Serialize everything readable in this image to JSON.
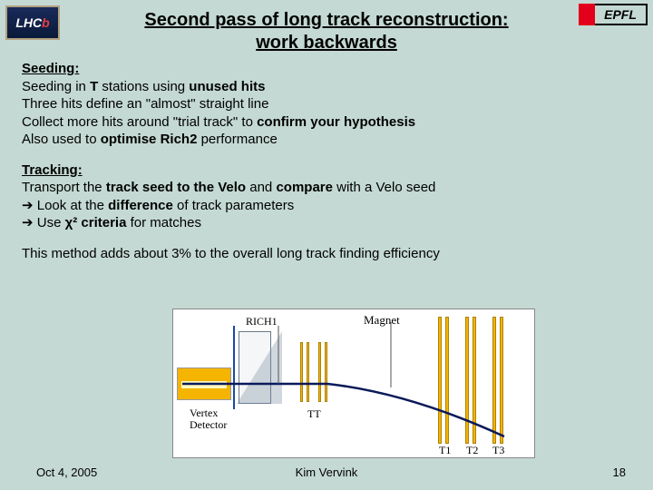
{
  "logos": {
    "lhcb_text_white": "LHC",
    "lhcb_text_red": "b",
    "epfl_text": "EPFL"
  },
  "title": {
    "line1": "Second pass of long track reconstruction:",
    "line2": "work backwards"
  },
  "seeding": {
    "head": "Seeding:",
    "l1_a": "Seeding in ",
    "l1_b": "T",
    "l1_c": " stations using ",
    "l1_d": "unused hits",
    "l2": "Three hits define an \"almost\" straight line",
    "l3_a": "Collect more hits around \"trial track\" to ",
    "l3_b": "confirm your hypothesis",
    "l4_a": "Also used to ",
    "l4_b": "optimise Rich2",
    "l4_c": " performance"
  },
  "tracking": {
    "head": "Tracking:",
    "l1_a": "Transport the ",
    "l1_b": "track seed to the Velo",
    "l1_c": " and ",
    "l1_d": "compare",
    "l1_e": " with a Velo seed",
    "l2_arrow": "➔",
    "l2_a": " Look at the ",
    "l2_b": "difference",
    "l2_c": " of track parameters",
    "l3_arrow": "➔",
    "l3_a": " Use ",
    "l3_b": "χ² criteria",
    "l3_c": " for matches"
  },
  "summary": "This method adds about 3% to the overall long track finding efficiency",
  "diagram": {
    "rich1": "RICH1",
    "magnet": "Magnet",
    "vertex": "Vertex\nDetector",
    "tt": "TT",
    "t1": "T1",
    "t2": "T2",
    "t3": "T3"
  },
  "footer": {
    "date": "Oct 4, 2005",
    "author": "Kim Vervink",
    "page": "18"
  }
}
